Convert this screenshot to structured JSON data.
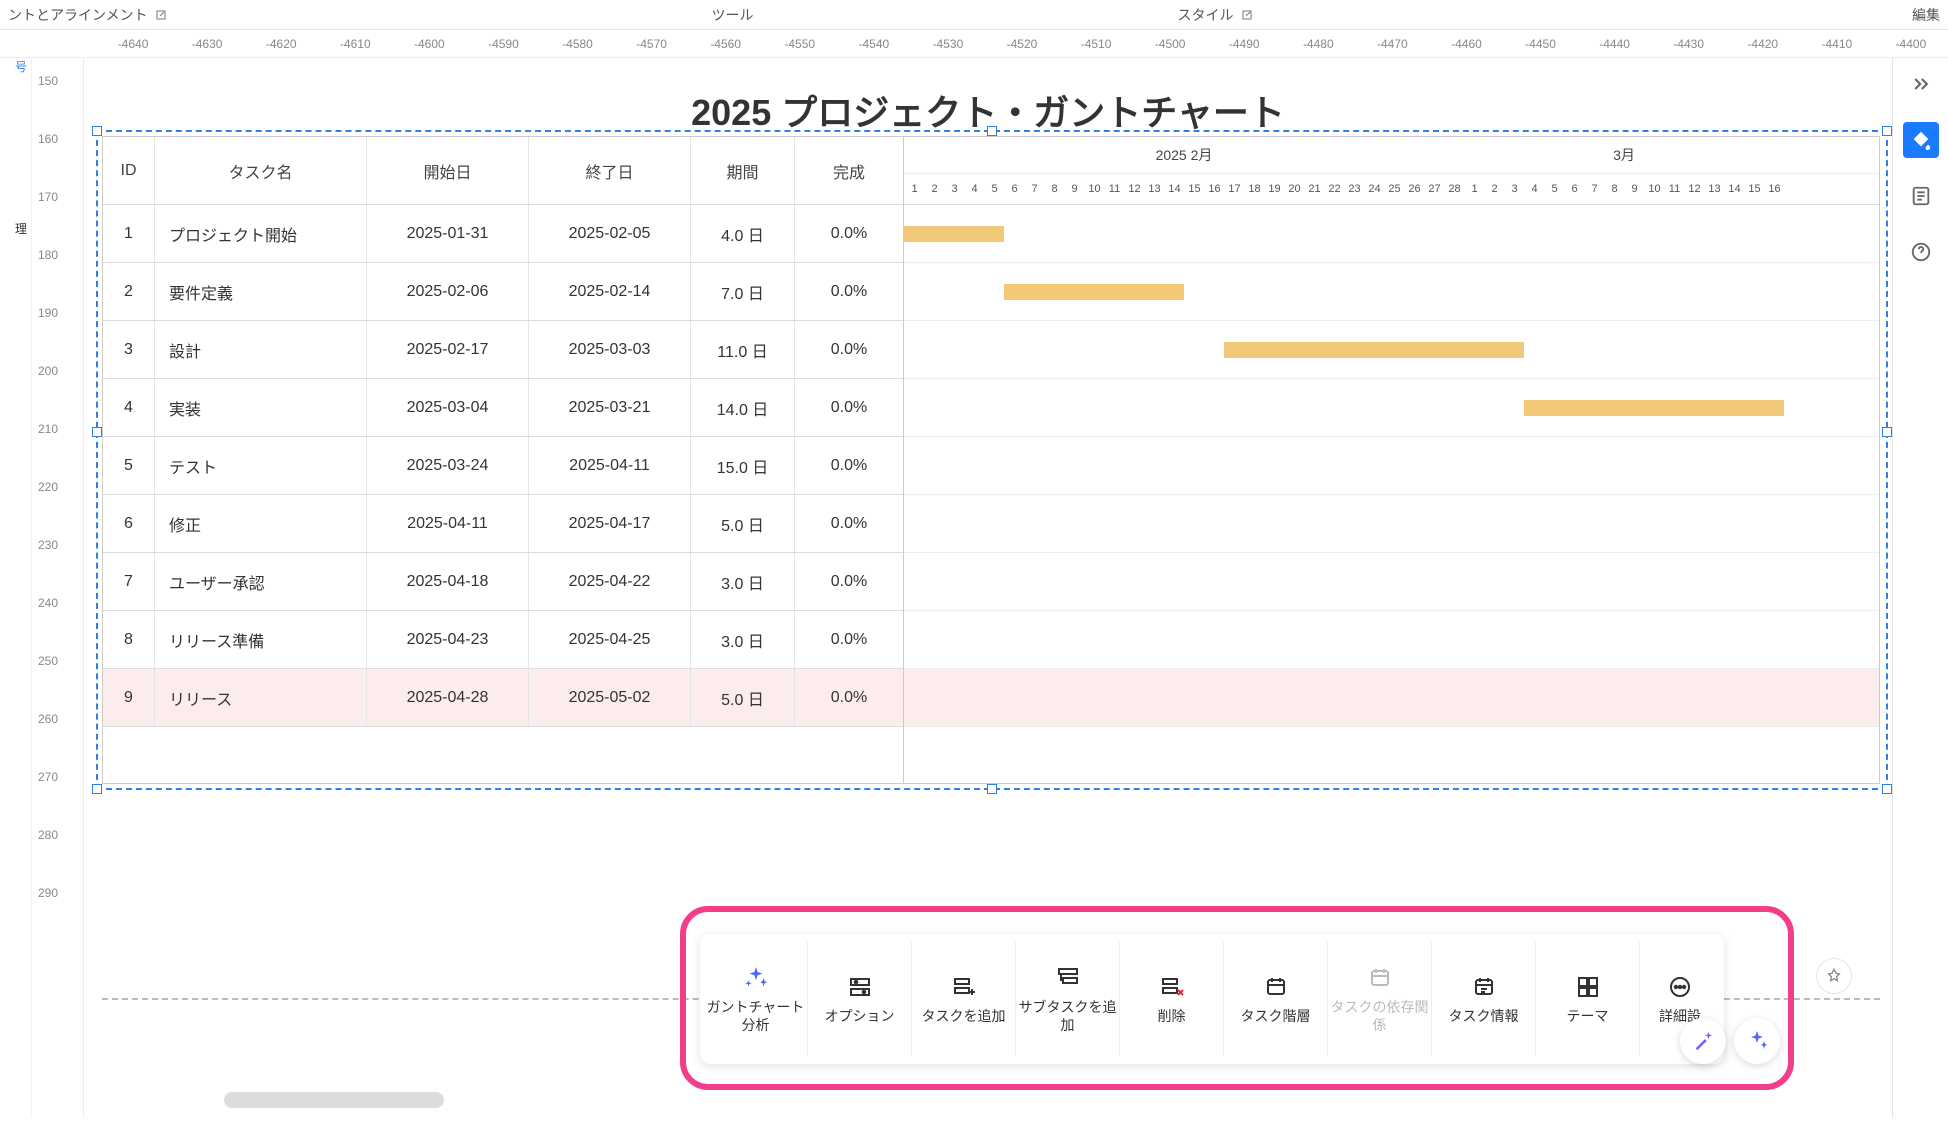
{
  "tabs": {
    "left": "ントとアラインメント",
    "center": "ツール",
    "right": "スタイル",
    "far": "編集"
  },
  "leftcol_label": "号",
  "leftcol_label2": "理",
  "hruler_ticks": [
    "-4640",
    "-4630",
    "-4620",
    "-4610",
    "-4600",
    "-4590",
    "-4580",
    "-4570",
    "-4560",
    "-4550",
    "-4540",
    "-4530",
    "-4520",
    "-4510",
    "-4500",
    "-4490",
    "-4480",
    "-4470",
    "-4460",
    "-4450",
    "-4440",
    "-4430",
    "-4420",
    "-4410",
    "-4400"
  ],
  "vruler_ticks": [
    "150",
    "160",
    "170",
    "180",
    "190",
    "200",
    "210",
    "220",
    "230",
    "240",
    "250",
    "260",
    "270",
    "280",
    "290"
  ],
  "title": "2025 プロジェクト・ガントチャート",
  "columns": {
    "id": "ID",
    "name": "タスク名",
    "start": "開始日",
    "end": "終了日",
    "dur": "期間",
    "done": "完成"
  },
  "tasks": [
    {
      "id": "1",
      "name": "プロジェクト開始",
      "start": "2025-01-31",
      "end": "2025-02-05",
      "dur": "4.0 日",
      "done": "0.0%"
    },
    {
      "id": "2",
      "name": "要件定義",
      "start": "2025-02-06",
      "end": "2025-02-14",
      "dur": "7.0 日",
      "done": "0.0%"
    },
    {
      "id": "3",
      "name": "設計",
      "start": "2025-02-17",
      "end": "2025-03-03",
      "dur": "11.0 日",
      "done": "0.0%"
    },
    {
      "id": "4",
      "name": "実装",
      "start": "2025-03-04",
      "end": "2025-03-21",
      "dur": "14.0 日",
      "done": "0.0%"
    },
    {
      "id": "5",
      "name": "テスト",
      "start": "2025-03-24",
      "end": "2025-04-11",
      "dur": "15.0 日",
      "done": "0.0%"
    },
    {
      "id": "6",
      "name": "修正",
      "start": "2025-04-11",
      "end": "2025-04-17",
      "dur": "5.0 日",
      "done": "0.0%"
    },
    {
      "id": "7",
      "name": "ユーザー承認",
      "start": "2025-04-18",
      "end": "2025-04-22",
      "dur": "3.0 日",
      "done": "0.0%"
    },
    {
      "id": "8",
      "name": "リリース準備",
      "start": "2025-04-23",
      "end": "2025-04-25",
      "dur": "3.0 日",
      "done": "0.0%"
    },
    {
      "id": "9",
      "name": "リリース",
      "start": "2025-04-28",
      "end": "2025-05-02",
      "dur": "5.0 日",
      "done": "0.0%"
    }
  ],
  "timeline": {
    "months": [
      {
        "label": "2025 2月",
        "days": 28
      },
      {
        "label": "3月",
        "days": 16
      }
    ],
    "day_width": 20,
    "col_offset": 0
  },
  "selected_row": 9,
  "float_toolbar": {
    "analyze": "ガントチャート分析",
    "options": "オプション",
    "add_task": "タスクを追加",
    "add_subtask": "サブタスクを追加",
    "delete": "削除",
    "hierarchy": "タスク階層",
    "dependency": "タスクの依存関係",
    "info": "タスク情報",
    "theme": "テーマ",
    "more": "詳細設"
  },
  "chart_data": {
    "type": "gantt",
    "title": "2025 プロジェクト・ガントチャート",
    "x_start": "2025-02-01",
    "x_end": "2025-03-16",
    "bars": [
      {
        "task": "プロジェクト開始",
        "start": "2025-01-31",
        "end": "2025-02-05",
        "progress": 0.0
      },
      {
        "task": "要件定義",
        "start": "2025-02-06",
        "end": "2025-02-14",
        "progress": 0.0
      },
      {
        "task": "設計",
        "start": "2025-02-17",
        "end": "2025-03-03",
        "progress": 0.0
      },
      {
        "task": "実装",
        "start": "2025-03-04",
        "end": "2025-03-21",
        "progress": 0.0
      },
      {
        "task": "テスト",
        "start": "2025-03-24",
        "end": "2025-04-11",
        "progress": 0.0
      },
      {
        "task": "修正",
        "start": "2025-04-11",
        "end": "2025-04-17",
        "progress": 0.0
      },
      {
        "task": "ユーザー承認",
        "start": "2025-04-18",
        "end": "2025-04-22",
        "progress": 0.0
      },
      {
        "task": "リリース準備",
        "start": "2025-04-23",
        "end": "2025-04-25",
        "progress": 0.0
      },
      {
        "task": "リリース",
        "start": "2025-04-28",
        "end": "2025-05-02",
        "progress": 0.0
      }
    ]
  }
}
